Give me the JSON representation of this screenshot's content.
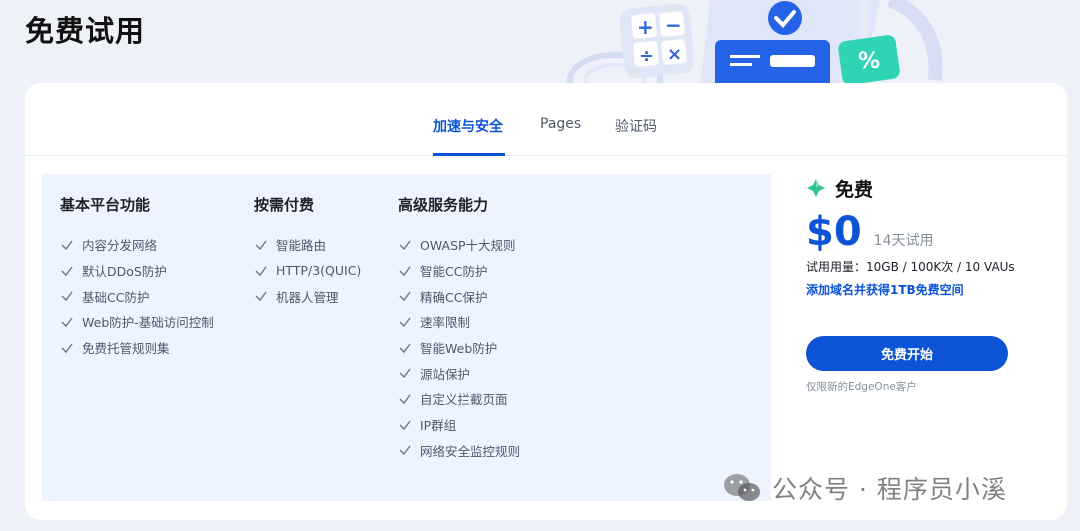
{
  "page_title": "免费试用",
  "tabs": [
    {
      "label": "加速与安全"
    },
    {
      "label": "Pages"
    },
    {
      "label": "验证码"
    }
  ],
  "columns": [
    {
      "title": "基本平台功能",
      "items": [
        "内容分发网络",
        "默认DDoS防护",
        "基础CC防护",
        "Web防护-基础访问控制",
        "免费托管规则集"
      ]
    },
    {
      "title": "按需付费",
      "items": [
        "智能路由",
        "HTTP/3(QUIC)",
        "机器人管理"
      ]
    },
    {
      "title": "高级服务能力",
      "items": [
        "OWASP十大规则",
        "智能CC防护",
        "精确CC保护",
        "速率限制",
        "智能Web防护",
        "源站保护",
        "自定义拦截页面",
        "IP群组",
        "网络安全监控规则"
      ]
    }
  ],
  "plan": {
    "name": "免费",
    "price": "$0",
    "trial": "14天试用",
    "quota": "试用用量：10GB / 100K次 / 10 VAUs",
    "promo": "添加域名并获得1TB免费空间",
    "cta": "免费开始",
    "note": "仅限新的EdgeOne客户"
  },
  "watermark": "公众号 · 程序员小溪",
  "colors": {
    "accent": "#0c53d6",
    "panel": "#eef4ff",
    "check": "#6b7785"
  }
}
